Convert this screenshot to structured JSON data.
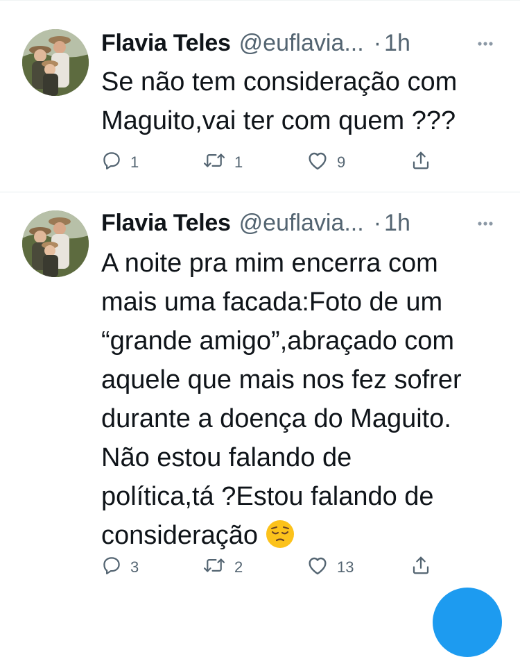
{
  "colors": {
    "text_primary": "#0f1419",
    "text_secondary": "#536471",
    "divider": "#e6ecf0",
    "accent_blue": "#1d9bf0"
  },
  "tweets": [
    {
      "display_name": "Flavia Teles",
      "handle": "@euflavia...",
      "separator": "·",
      "time": "1h",
      "text_lines": [
        "Se não tem consideração com",
        "Maguito,vai ter com quem ???"
      ],
      "emoji": null,
      "actions": {
        "replies": "1",
        "retweets": "1",
        "likes": "9"
      },
      "icons": [
        "reply-icon",
        "retweet-icon",
        "like-icon",
        "share-icon",
        "more-icon"
      ]
    },
    {
      "display_name": "Flavia Teles",
      "handle": "@euflavia...",
      "separator": "·",
      "time": "1h",
      "text_lines": [
        "A noite pra mim encerra com",
        "mais uma facada:Foto de um",
        "“grande amigo”,abraçado com",
        "aquele que mais nos fez sofrer",
        "durante a doença do Maguito.",
        "Não estou falando de",
        "política,tá ?Estou falando de",
        "consideração"
      ],
      "emoji": "pensive-face",
      "actions": {
        "replies": "3",
        "retweets": "2",
        "likes": "13"
      },
      "icons": [
        "reply-icon",
        "retweet-icon",
        "like-icon",
        "share-icon",
        "more-icon"
      ]
    }
  ],
  "floating_button": "compose-tweet-button"
}
